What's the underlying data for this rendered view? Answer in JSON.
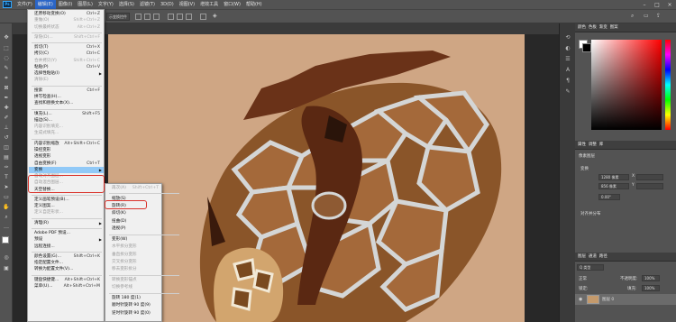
{
  "menubar": {
    "logo": "Ps",
    "items": [
      "文件(F)",
      "编辑(E)",
      "图像(I)",
      "图层(L)",
      "文字(Y)",
      "选择(S)",
      "滤镜(T)",
      "3D(D)",
      "视图(V)",
      "增效工具",
      "窗口(W)",
      "帮助(H)"
    ],
    "window_controls": [
      "–",
      "□",
      "×"
    ]
  },
  "options": {
    "partial_label": "示变换控件"
  },
  "edit_menu": [
    {
      "label": "还原移动变换(O)",
      "shortcut": "Ctrl+Z"
    },
    {
      "label": "重做(O)",
      "shortcut": "Shift+Ctrl+Z",
      "disabled": true
    },
    {
      "label": "切换最终状态",
      "shortcut": "Alt+Ctrl+Z",
      "disabled": true
    },
    {
      "sep": true
    },
    {
      "label": "渐隐(D)...",
      "shortcut": "Shift+Ctrl+F",
      "disabled": true
    },
    {
      "sep": true
    },
    {
      "label": "剪切(T)",
      "shortcut": "Ctrl+X"
    },
    {
      "label": "拷贝(C)",
      "shortcut": "Ctrl+C"
    },
    {
      "label": "合并拷贝(Y)",
      "shortcut": "Shift+Ctrl+C",
      "disabled": true
    },
    {
      "label": "粘贴(P)",
      "shortcut": "Ctrl+V"
    },
    {
      "label": "选择性粘贴(I)",
      "arrow": true
    },
    {
      "label": "清除(E)",
      "disabled": true
    },
    {
      "sep": true
    },
    {
      "label": "搜索",
      "shortcut": "Ctrl+F"
    },
    {
      "label": "拼写检查(H)..."
    },
    {
      "label": "查找和替换文本(X)..."
    },
    {
      "sep": true
    },
    {
      "label": "填充(L)...",
      "shortcut": "Shift+F5"
    },
    {
      "label": "描边(S)..."
    },
    {
      "label": "内容识别填充...",
      "disabled": true
    },
    {
      "label": "生成式填充...",
      "disabled": true
    },
    {
      "sep": true
    },
    {
      "label": "内容识别缩放",
      "shortcut": "Alt+Shift+Ctrl+C"
    },
    {
      "label": "操控变形"
    },
    {
      "label": "透视变形"
    },
    {
      "label": "自由变换(F)",
      "shortcut": "Ctrl+T"
    },
    {
      "label": "变换",
      "arrow": true,
      "highlight": true
    },
    {
      "label": "自动对齐图层...",
      "disabled": true
    },
    {
      "label": "自动混合图层...",
      "disabled": true
    },
    {
      "label": "天空替换..."
    },
    {
      "sep": true
    },
    {
      "label": "定义画笔预设(B)..."
    },
    {
      "label": "定义图案..."
    },
    {
      "label": "定义自定形状...",
      "disabled": true
    },
    {
      "sep": true
    },
    {
      "label": "清理(R)",
      "arrow": true
    },
    {
      "sep": true
    },
    {
      "label": "Adobe PDF 预设..."
    },
    {
      "label": "预设",
      "arrow": true
    },
    {
      "label": "远程连接..."
    },
    {
      "sep": true
    },
    {
      "label": "颜色设置(G)...",
      "shortcut": "Shift+Ctrl+K"
    },
    {
      "label": "指定配置文件..."
    },
    {
      "label": "转换为配置文件(V)..."
    },
    {
      "sep": true
    },
    {
      "label": "键盘快捷键...",
      "shortcut": "Alt+Shift+Ctrl+K"
    },
    {
      "label": "菜单(U)...",
      "shortcut": "Alt+Shift+Ctrl+M"
    }
  ],
  "transform_menu": [
    {
      "label": "再次(A)",
      "shortcut": "Shift+Ctrl+T",
      "disabled": true
    },
    {
      "sep": true
    },
    {
      "label": "缩放(S)"
    },
    {
      "label": "旋转(R)",
      "boxed": true
    },
    {
      "label": "斜切(K)"
    },
    {
      "label": "扭曲(D)"
    },
    {
      "label": "透视(P)"
    },
    {
      "sep": true
    },
    {
      "label": "变形(W)"
    },
    {
      "label": "水平拆分变形",
      "disabled": true
    },
    {
      "label": "垂直拆分变形",
      "disabled": true
    },
    {
      "label": "交叉拆分变形",
      "disabled": true
    },
    {
      "label": "移去变形拆分",
      "disabled": true
    },
    {
      "sep": true
    },
    {
      "label": "转换变形锚点",
      "disabled": true
    },
    {
      "label": "切换参考线",
      "disabled": true
    },
    {
      "sep": true
    },
    {
      "label": "旋转 180 度(1)"
    },
    {
      "label": "顺时针旋转 90 度(9)"
    },
    {
      "label": "逆时针旋转 90 度(0)"
    }
  ],
  "panels": {
    "color_tabs": [
      "颜色",
      "色板",
      "渐变",
      "图案"
    ],
    "properties_tabs": [
      "属性",
      "调整",
      "库"
    ],
    "properties_type": "像素图层",
    "transform_title": "变换",
    "w_value": "1280 像素",
    "h_value": "856 像素",
    "x_label": "X",
    "y_label": "Y",
    "angle_value": "0.00°",
    "align_title": "对齐并分布",
    "layers_tabs": [
      "图层",
      "通道",
      "路径"
    ],
    "kind_label": "Q 类型",
    "blend_mode": "正常",
    "opacity_label": "不透明度:",
    "opacity_value": "100%",
    "lock_label": "锁定:",
    "fill_label": "填充:",
    "fill_value": "100%",
    "layer_name": "图层 0"
  },
  "colors": {
    "canvas_bg": "#cfa684",
    "highlight": "#91c9f7",
    "callout": "#d9322a"
  }
}
